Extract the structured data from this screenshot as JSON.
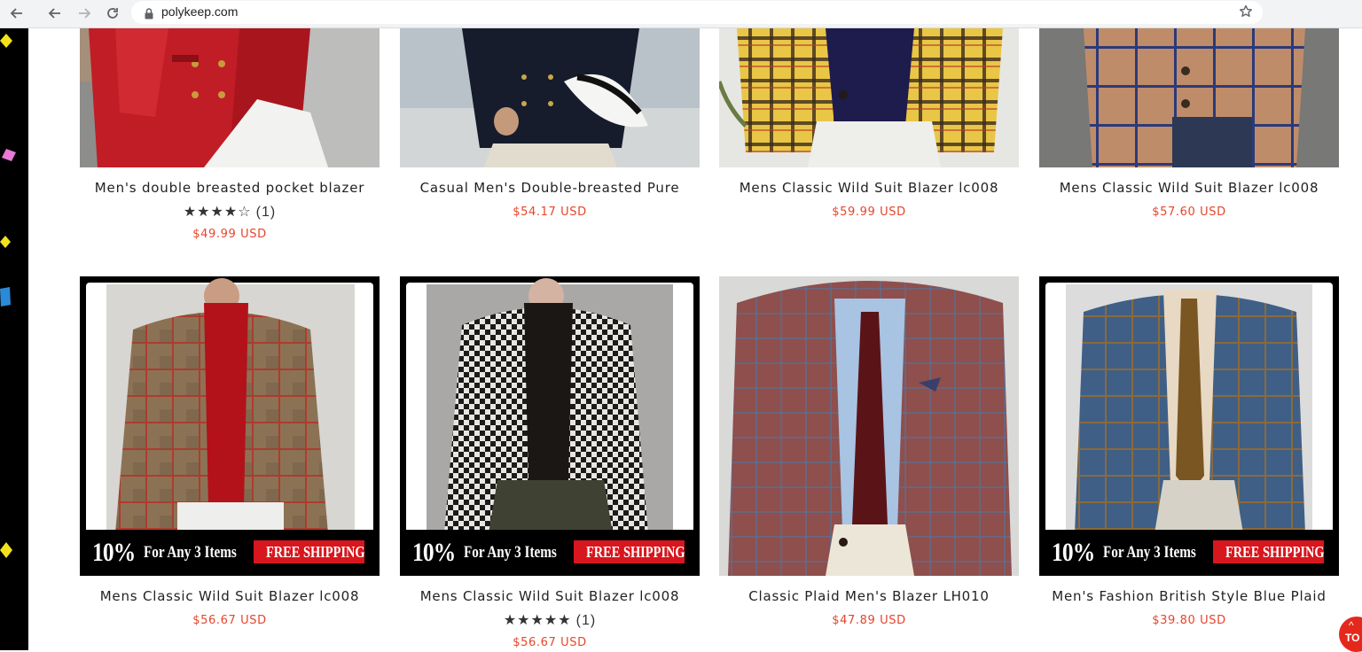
{
  "browser": {
    "url": "polykeep.com",
    "icons": [
      "back-arrow-icon",
      "back-icon",
      "forward-icon",
      "reload-icon",
      "lock-icon",
      "star-icon"
    ]
  },
  "promo_banner": {
    "percent": "10%",
    "text": "For Any 3 Items",
    "shipping": "FREE SHIPPING"
  },
  "products": [
    {
      "title": "Men's double breasted pocket blazer",
      "price": "$49.99 USD",
      "rating_stars": "★★★★☆",
      "rating_count": "(1)"
    },
    {
      "title": "Casual Men's Double-breasted Pure",
      "price": "$54.17 USD"
    },
    {
      "title": "Mens Classic Wild Suit Blazer lc008",
      "price": "$59.99 USD"
    },
    {
      "title": "Mens Classic Wild Suit Blazer lc008",
      "price": "$57.60 USD"
    },
    {
      "title": "Mens Classic Wild Suit Blazer lc008",
      "price": "$56.67 USD"
    },
    {
      "title": "Mens Classic Wild Suit Blazer lc008",
      "price": "$56.67 USD",
      "rating_stars": "★★★★★",
      "rating_count": "(1)"
    },
    {
      "title": "Classic Plaid Men's Blazer LH010",
      "price": "$47.89 USD"
    },
    {
      "title": "Men's Fashion British Style Blue Plaid",
      "price": "$39.80 USD"
    }
  ],
  "to_top": {
    "arrow": "^",
    "label": "TO"
  },
  "colors": {
    "price": "#e8442b",
    "shipping_badge": "#d8161d",
    "to_top": "#e4281c"
  }
}
